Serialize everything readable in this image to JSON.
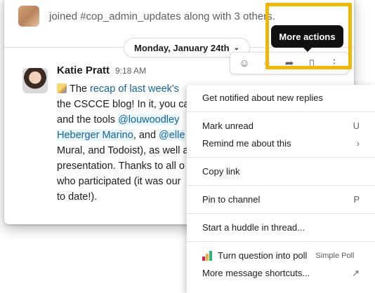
{
  "channel_event": {
    "join_text": "joined #cop_admin_updates along with 3 others."
  },
  "date_divider": {
    "label": "Monday, January 24th",
    "chevron": "chevron-down-icon"
  },
  "message": {
    "author": "Katie Pratt",
    "time": "9:18 AM",
    "lines": [
      {
        "pre": "The ",
        "link": "recap of last week's"
      },
      {
        "text": "the CSCCE blog! In it, you ca"
      },
      {
        "pre": "and the tools ",
        "mention": "@louwoodley"
      },
      {
        "mention": "Heberger Marino",
        "mid": ", and ",
        "mention2": "@elle"
      },
      {
        "text": "Mural, and Todoist), as well a"
      },
      {
        "text": "presentation. Thanks to all o"
      },
      {
        "text": "who participated (it was our"
      },
      {
        "text": "to date!)."
      }
    ]
  },
  "toolbar": {
    "icons": [
      "add-reaction-icon",
      "reply-in-thread-icon",
      "share-icon",
      "bookmark-icon",
      "more-actions-icon"
    ],
    "tooltip": "More actions"
  },
  "menu": {
    "items": [
      {
        "label": "Get notified about new replies",
        "shortcut": ""
      },
      {
        "label": "Mark unread",
        "shortcut": "U"
      },
      {
        "label": "Remind me about this",
        "shortcut": "›"
      },
      {
        "label": "Copy link",
        "shortcut": ""
      },
      {
        "label": "Pin to channel",
        "shortcut": "P"
      },
      {
        "label": "Start a huddle in thread...",
        "shortcut": ""
      },
      {
        "label": "Turn question into poll",
        "app": "Simple Poll"
      },
      {
        "label": "More message shortcuts...",
        "shortcut": "↗"
      }
    ]
  },
  "colors": {
    "highlight": "#f2b705",
    "link": "#1264a3",
    "tooltip_bg": "#111111"
  }
}
